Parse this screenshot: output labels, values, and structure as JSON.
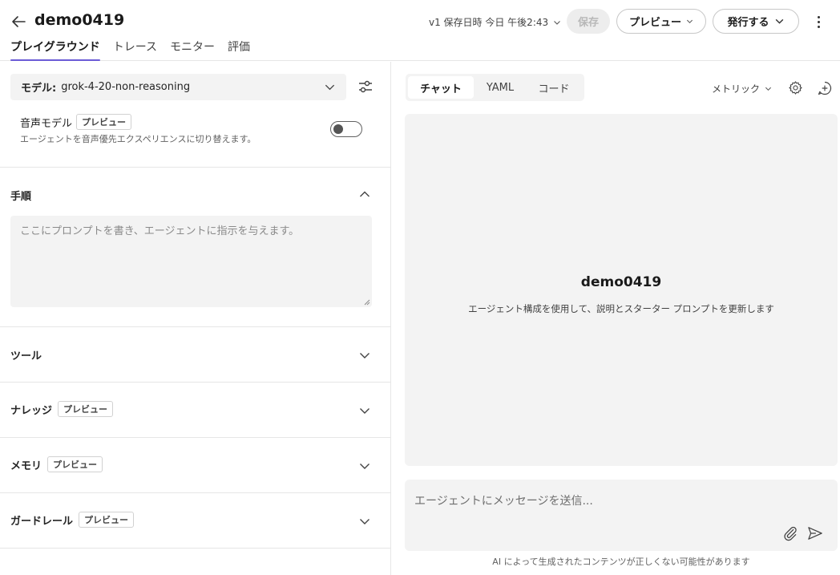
{
  "header": {
    "title": "demo0419",
    "tabs": [
      {
        "label": "プレイグラウンド",
        "active": true
      },
      {
        "label": "トレース",
        "active": false
      },
      {
        "label": "モニター",
        "active": false
      },
      {
        "label": "評価",
        "active": false
      }
    ],
    "version_status": "v1 保存日時 今日 午後2:43",
    "save_label": "保存",
    "preview_label": "プレビュー",
    "publish_label": "発行する"
  },
  "left": {
    "model": {
      "label": "モデル:",
      "value": "grok-4-20-non-reasoning"
    },
    "voice": {
      "title": "音声モデル",
      "badge": "プレビュー",
      "description": "エージェントを音声優先エクスペリエンスに切り替えます。",
      "enabled": false
    },
    "instructions": {
      "title": "手順",
      "placeholder": "ここにプロンプトを書き、エージェントに指示を与えます。",
      "expanded": true
    },
    "sections": [
      {
        "title": "ツール",
        "badge": ""
      },
      {
        "title": "ナレッジ",
        "badge": "プレビュー"
      },
      {
        "title": "メモリ",
        "badge": "プレビュー"
      },
      {
        "title": "ガードレール",
        "badge": "プレビュー"
      }
    ]
  },
  "right": {
    "tabs": [
      {
        "label": "チャット",
        "active": true
      },
      {
        "label": "YAML",
        "active": false
      },
      {
        "label": "コード",
        "active": false
      }
    ],
    "metrics_label": "メトリック",
    "canvas_title": "demo0419",
    "canvas_subtitle": "エージェント構成を使用して、説明とスターター プロンプトを更新します",
    "message_placeholder": "エージェントにメッセージを送信...",
    "footer": "AI によって生成されたコンテンツが正しくない可能性があります"
  },
  "colors": {
    "accent": "#6b5bd6",
    "panel": "#f3f3f3"
  }
}
